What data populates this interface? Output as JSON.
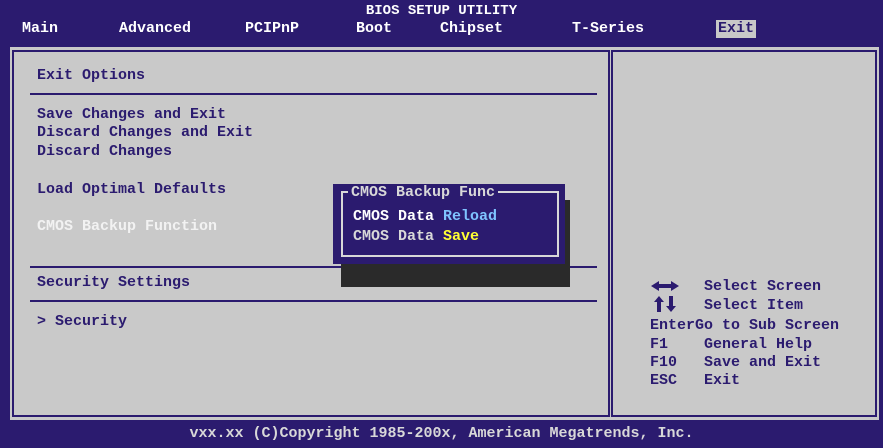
{
  "header": {
    "title": "BIOS SETUP UTILITY",
    "menu": {
      "main": "Main",
      "advanced": "Advanced",
      "pcipnp": "PCIPnP",
      "boot": "Boot",
      "chipset": "Chipset",
      "tseries": "T-Series",
      "exit": "Exit"
    }
  },
  "exit_panel": {
    "section_exit_options": "Exit Options",
    "items": [
      "Save Changes and Exit",
      "Discard Changes and Exit",
      "Discard Changes",
      "Load Optimal Defaults",
      "CMOS Backup Function"
    ],
    "section_security": "Security Settings",
    "security_item": "> Security"
  },
  "popup": {
    "title": "CMOS Backup Func",
    "options": [
      {
        "prefix": "CMOS Data ",
        "keyword": "Reload"
      },
      {
        "prefix": "CMOS Data ",
        "keyword": "Save"
      }
    ]
  },
  "help": {
    "rows": [
      {
        "key": "",
        "action": "Select Screen"
      },
      {
        "key": "",
        "action": "Select Item"
      },
      {
        "key": "Enter",
        "action": "Go to Sub Screen"
      },
      {
        "key": "F1",
        "action": "General Help"
      },
      {
        "key": "F10",
        "action": "Save and Exit"
      },
      {
        "key": "ESC",
        "action": "Exit"
      }
    ]
  },
  "footer": {
    "copyright": "vxx.xx (C)Copyright 1985-200x, American Megatrends, Inc."
  },
  "colors": {
    "bios_blue": "#2b1b6f",
    "panel_gray": "#c9c9c9",
    "reload_highlight": "#7fc3ff",
    "save_highlight": "#ffff33"
  }
}
